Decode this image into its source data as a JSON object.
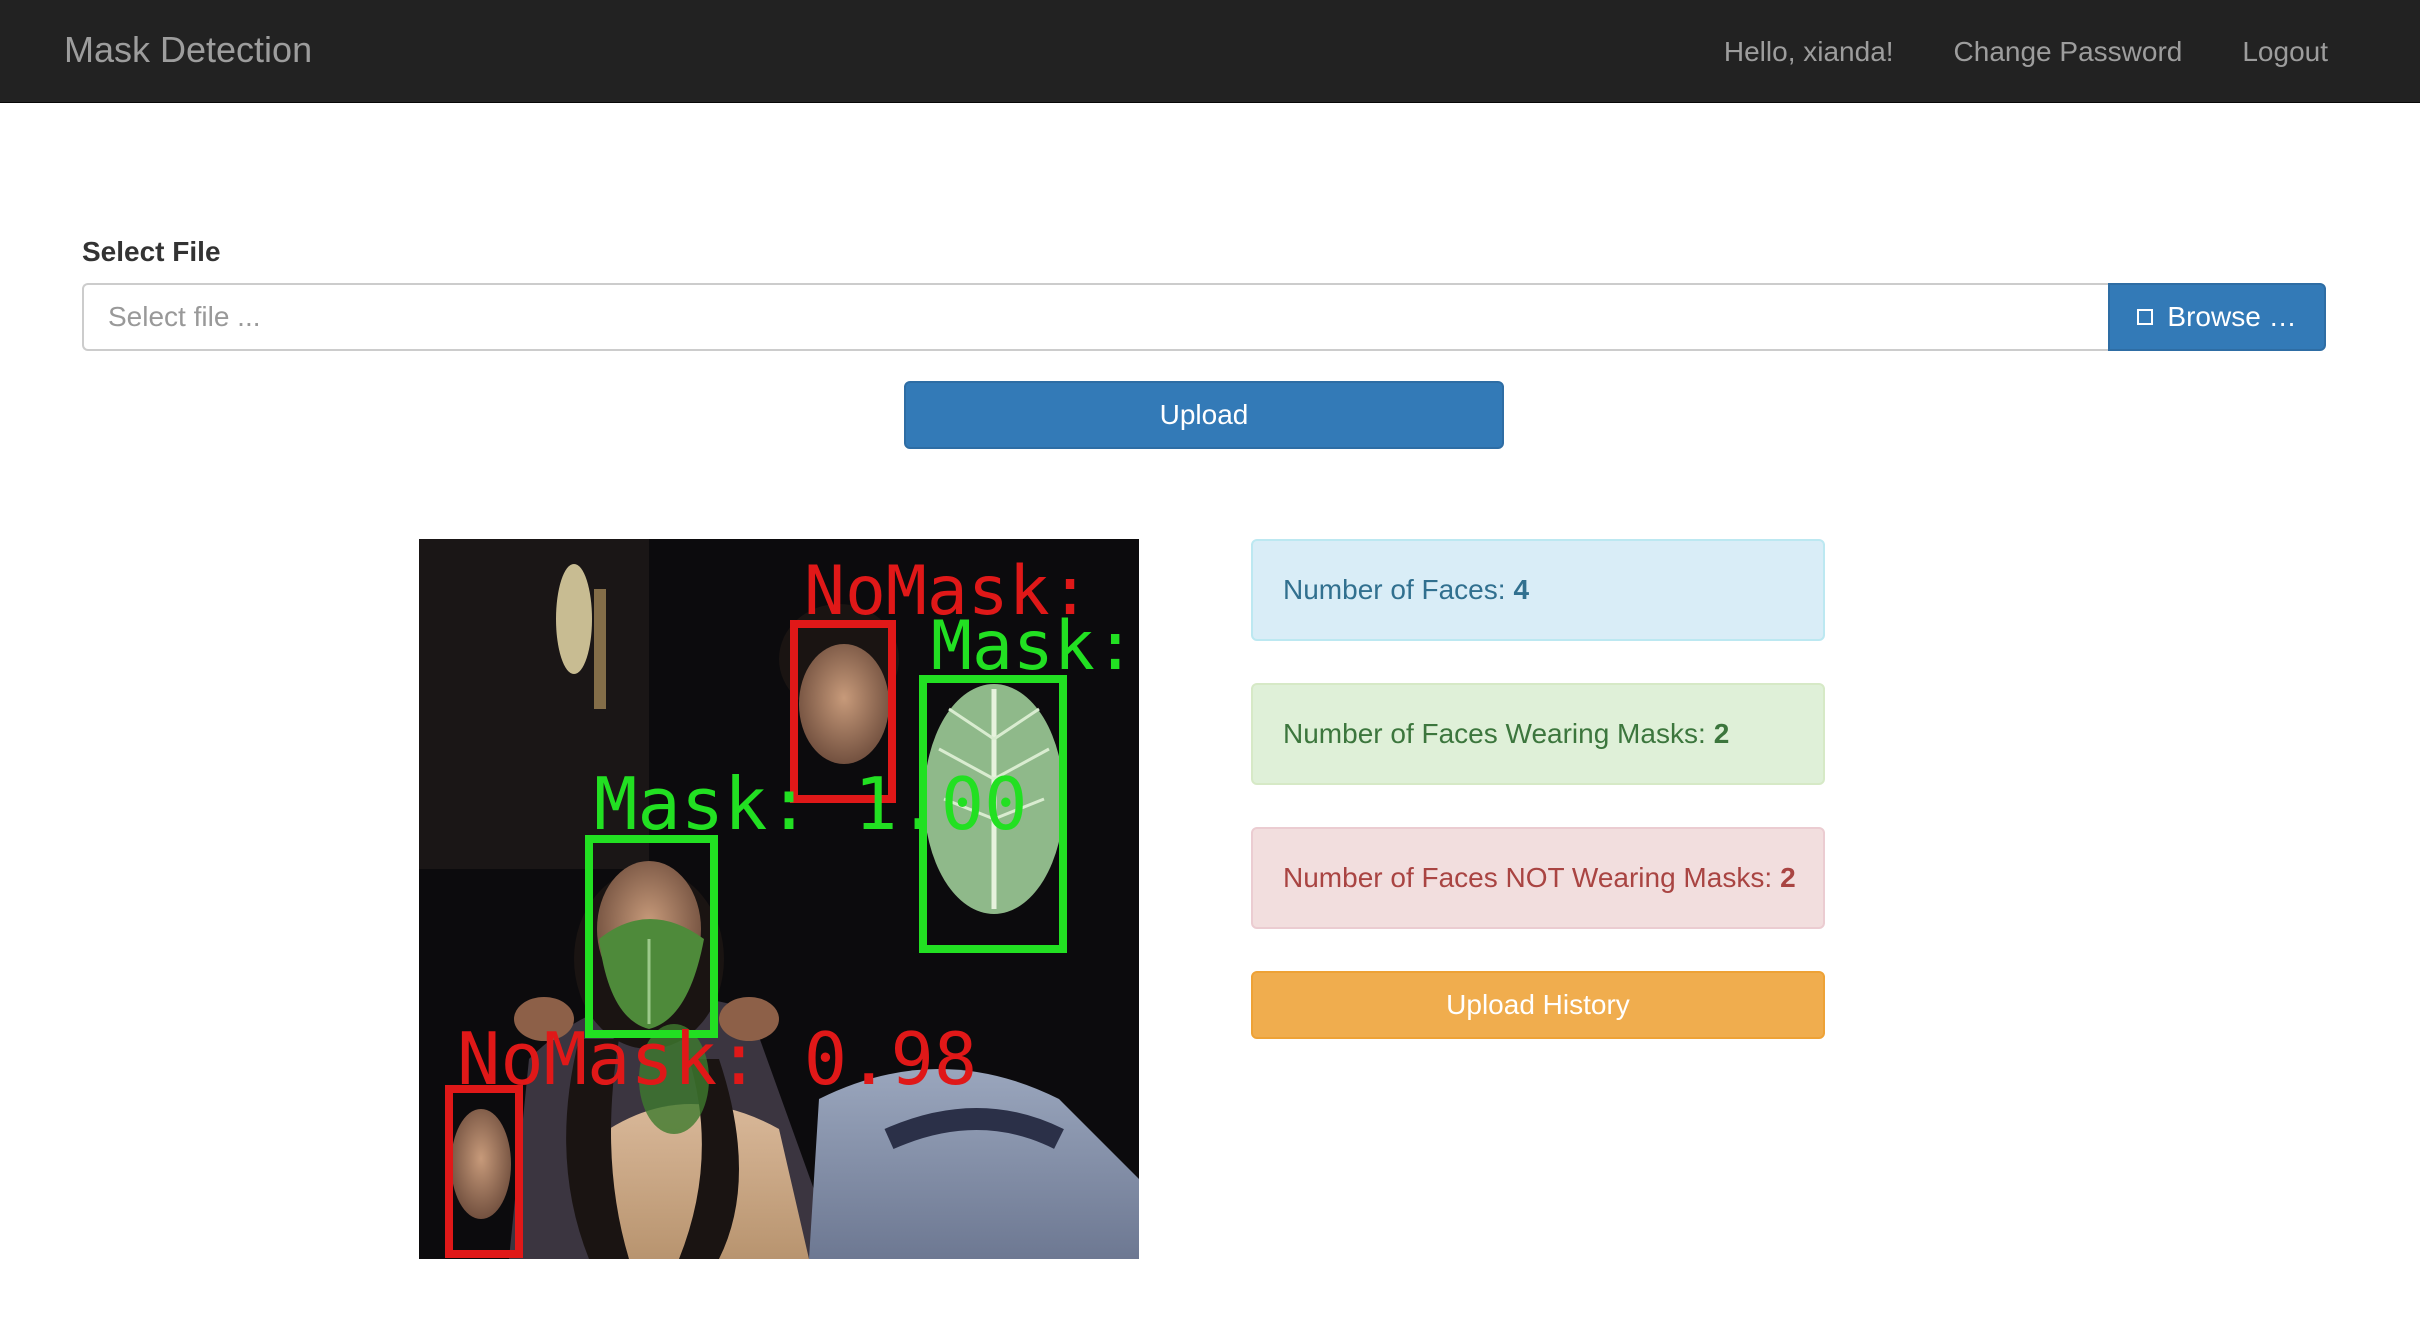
{
  "navbar": {
    "brand": "Mask Detection",
    "greeting": "Hello, xianda!",
    "change_password": "Change Password",
    "logout": "Logout"
  },
  "form": {
    "label": "Select File",
    "file_placeholder": "Select file ...",
    "browse_label": "Browse …",
    "upload_label": "Upload"
  },
  "image": {
    "labels": {
      "nomask_top": "NoMask:",
      "mask_right": "Mask:",
      "mask_center": "Mask: 1.00",
      "nomask_bottom": "NoMask: 0.98"
    }
  },
  "results": {
    "faces_label": "Number of Faces:",
    "faces_value": "4",
    "mask_label": "Number of Faces Wearing Masks:",
    "mask_value": "2",
    "nomask_label": "Number of Faces NOT Wearing Masks:",
    "nomask_value": "2"
  },
  "history_button": "Upload History",
  "colors": {
    "navbar": "#222222",
    "primary": "#337ab7",
    "warning": "#f0ad4e",
    "box_mask": "#22e022",
    "box_nomask": "#e01818"
  }
}
